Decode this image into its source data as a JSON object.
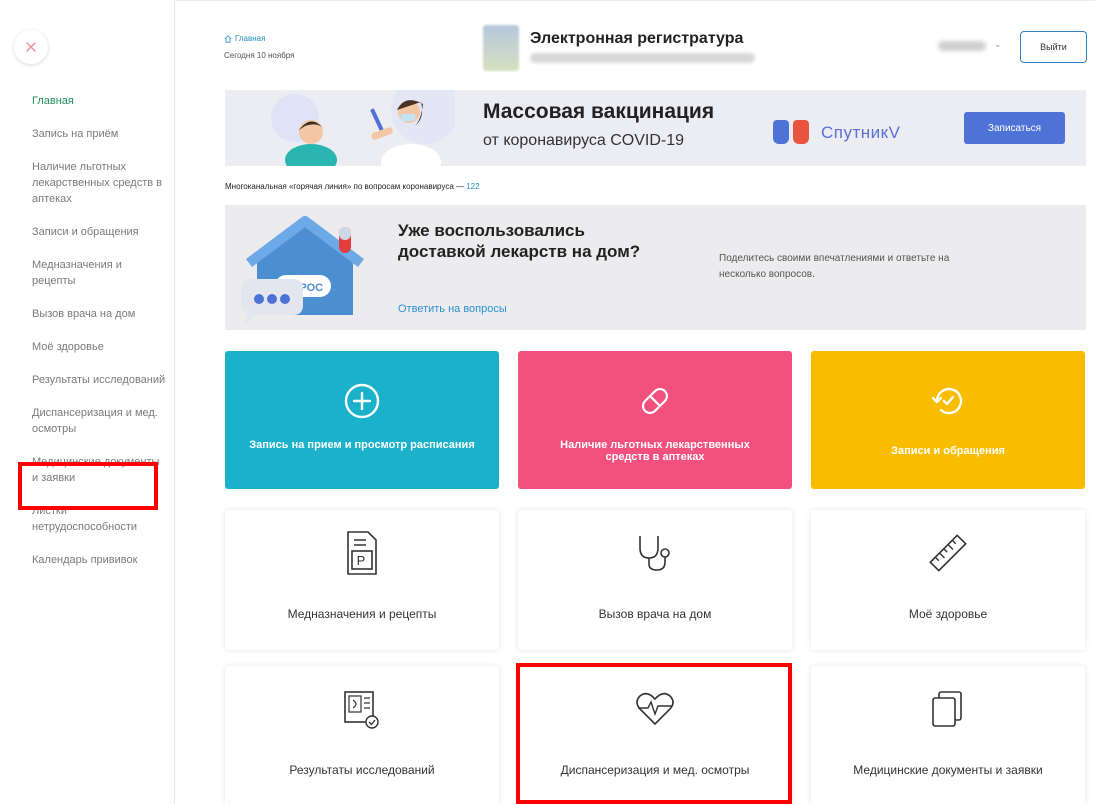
{
  "sidebar": {
    "items": [
      {
        "label": "Главная"
      },
      {
        "label": "Запись на приём"
      },
      {
        "label": "Наличие льготных лекарственных средств в аптеках"
      },
      {
        "label": "Записи и обращения"
      },
      {
        "label": "Медназначения и рецепты"
      },
      {
        "label": "Вызов врача на дом"
      },
      {
        "label": "Моё здоровье"
      },
      {
        "label": "Результаты исследований"
      },
      {
        "label": "Диспансеризация и мед. осмотры"
      },
      {
        "label": "Медицинские документы и заявки"
      },
      {
        "label": "Листки нетрудоспособности"
      },
      {
        "label": "Календарь прививок"
      }
    ]
  },
  "header": {
    "breadcrumb": "Главная",
    "date": "Сегодня 10 ноября",
    "title": "Электронная регистратура",
    "logout": "Выйти"
  },
  "banner": {
    "title": "Массовая вакцинация",
    "subtitle": "от коронавируса COVID-19",
    "brand": "СпутникV",
    "button": "Записаться"
  },
  "hotline": {
    "text": "Многоканальная «горячая линия» по вопросам коронавируса — ",
    "number": "122"
  },
  "survey": {
    "badge": "ОПРОС",
    "title": "Уже воспользовались доставкой лекарств на дом?",
    "link": "Ответить на вопросы",
    "description": "Поделитесь своими впечатлениями и ответьте на несколько вопросов."
  },
  "tiles": {
    "row1": [
      {
        "label": "Запись на прием и просмотр расписания",
        "icon": "plus-circle-icon",
        "color": "#1bb1cb"
      },
      {
        "label": "Наличие льготных лекарственных средств в аптеках",
        "icon": "pill-icon",
        "color": "#f2507d"
      },
      {
        "label": "Записи и обращения",
        "icon": "history-icon",
        "color": "#f8bc00"
      }
    ],
    "row2": [
      {
        "label": "Медназначения и рецепты",
        "icon": "prescription-icon"
      },
      {
        "label": "Вызов врача на дом",
        "icon": "stethoscope-icon"
      },
      {
        "label": "Моё здоровье",
        "icon": "ruler-icon"
      }
    ],
    "row3": [
      {
        "label": "Результаты исследований",
        "icon": "lab-results-icon"
      },
      {
        "label": "Диспансеризация и мед. осмотры",
        "icon": "heart-pulse-icon"
      },
      {
        "label": "Медицинские документы и заявки",
        "icon": "documents-icon"
      }
    ]
  },
  "colors": {
    "accent": "#2f83c6",
    "highlight": "#ff0000",
    "active_nav": "#1f8f5a"
  }
}
